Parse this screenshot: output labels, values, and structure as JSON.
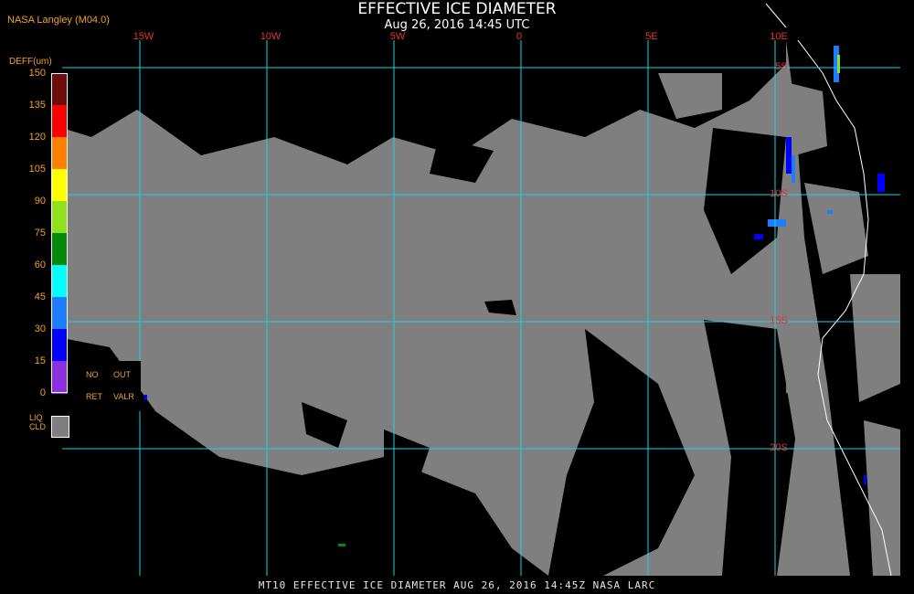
{
  "header": {
    "title": "EFFECTIVE ICE DIAMETER",
    "datetime": "Aug 26, 2016 14:45 UTC",
    "source": "NASA Langley (M04.0)"
  },
  "footer": {
    "caption": "MT10   EFFECTIVE ICE DIAMETER   AUG 26, 2016 14:45Z   NASA LARC"
  },
  "map": {
    "longitude_labels": [
      "15W",
      "10W",
      "5W",
      "0",
      "5E",
      "10E"
    ],
    "latitude_labels": [
      "5S",
      "10S",
      "15S",
      "20S"
    ],
    "grid_color": "#19d3e6",
    "land_color": "#7f7f7f",
    "background_color": "#000000"
  },
  "legend": {
    "title": "DEFF(um)",
    "ticks": [
      "150",
      "135",
      "120",
      "105",
      "90",
      "75",
      "60",
      "45",
      "30",
      "15",
      "0"
    ],
    "colors": [
      "#6e0c0c",
      "#ff0000",
      "#ff8000",
      "#ffff00",
      "#90e01e",
      "#06880a",
      "#00ffff",
      "#1e7cff",
      "#0000ff",
      "#8c2fe0"
    ],
    "no_retrieval": {
      "line1a": "NO",
      "line1b": "OUT",
      "line2a": "RET",
      "line2b": "VALR"
    },
    "liquid_cloud": {
      "line1": "LIQ",
      "line2": "CLD"
    }
  }
}
